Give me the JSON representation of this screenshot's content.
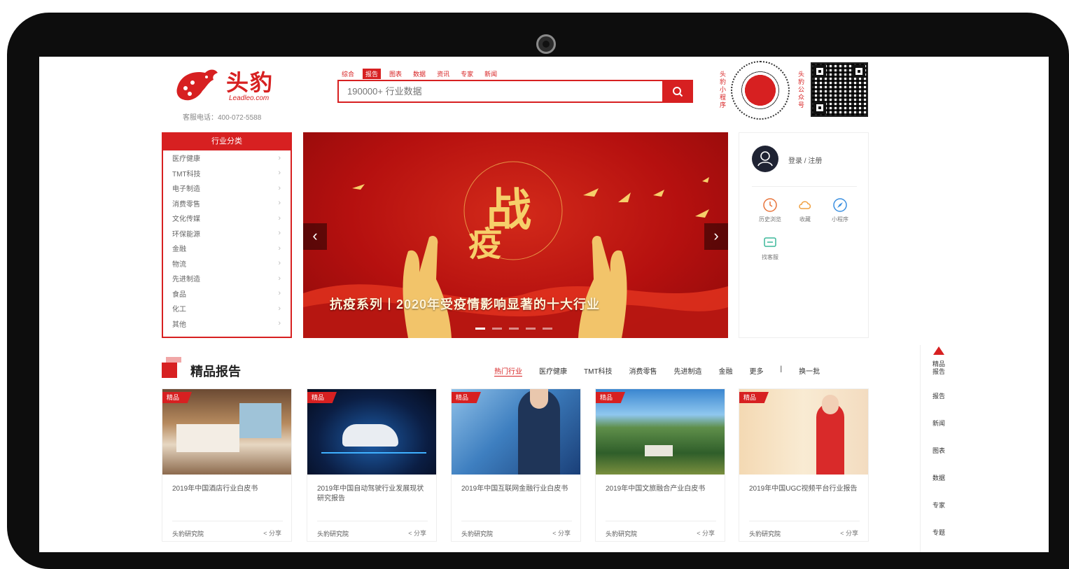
{
  "header": {
    "logo_text": "头豹",
    "logo_sub": "Leadleo.com",
    "hotline": "客服电话：400-072-5588",
    "search_tabs": [
      "综合",
      "报告",
      "图表",
      "数据",
      "资讯",
      "专家",
      "新闻"
    ],
    "search_active_index": 1,
    "search_placeholder": "190000+ 行业数据",
    "qr_left_label": "头豹小程序",
    "qr_right_label": "头豹公众号"
  },
  "sidebar": {
    "title": "行业分类",
    "items": [
      {
        "label": "医疗健康"
      },
      {
        "label": "TMT科技"
      },
      {
        "label": "电子制造"
      },
      {
        "label": "消费零售"
      },
      {
        "label": "文化传媒"
      },
      {
        "label": "环保能源"
      },
      {
        "label": "金融"
      },
      {
        "label": "物流"
      },
      {
        "label": "先进制造"
      },
      {
        "label": "食品"
      },
      {
        "label": "化工"
      },
      {
        "label": "其他"
      }
    ]
  },
  "banner": {
    "caption": "抗疫系列丨2020年受疫情影响显著的十大行业",
    "big_char_1": "战",
    "big_char_2": "疫",
    "prev": "‹",
    "next": "›",
    "active_dot": 0
  },
  "user": {
    "login_text": "登录 / 注册",
    "services": [
      {
        "label": "历史浏览",
        "icon": "clock-icon"
      },
      {
        "label": "收藏",
        "icon": "cloud-icon"
      },
      {
        "label": "小程序",
        "icon": "compass-icon"
      },
      {
        "label": "找客服",
        "icon": "chat-icon"
      }
    ]
  },
  "section": {
    "title": "精品报告",
    "tabs": [
      "热门行业",
      "医疗健康",
      "TMT科技",
      "消费零售",
      "先进制造",
      "金融",
      "更多",
      "|",
      "换一批"
    ],
    "active_tab": 0
  },
  "cards": [
    {
      "badge": "精品",
      "title": "2019年中国酒店行业白皮书",
      "source": "头豹研究院",
      "share": "分享"
    },
    {
      "badge": "精品",
      "title": "2019年中国自动驾驶行业发展现状研究报告",
      "source": "头豹研究院",
      "share": "分享"
    },
    {
      "badge": "精品",
      "title": "2019年中国互联网金融行业白皮书",
      "source": "头豹研究院",
      "share": "分享"
    },
    {
      "badge": "精品",
      "title": "2019年中国文旅融合产业白皮书",
      "source": "头豹研究院",
      "share": "分享"
    },
    {
      "badge": "精品",
      "title": "2019年中国UGC视频平台行业报告",
      "source": "头豹研究院",
      "share": "分享"
    }
  ],
  "float_bar": {
    "items": [
      "精品报告",
      "报告",
      "新闻",
      "图表",
      "数据",
      "专家",
      "专题"
    ]
  },
  "colors": {
    "brand": "#d72021"
  }
}
